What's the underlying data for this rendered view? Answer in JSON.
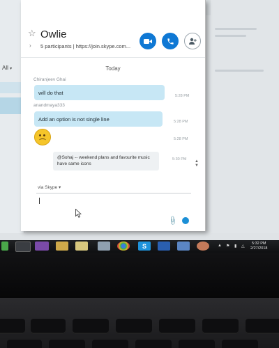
{
  "background_window": {
    "filter_label": "All",
    "filter_icon": "chevron-down-icon"
  },
  "chat": {
    "title": "Owlie",
    "participants": "5 participants | https://join.skype.com...",
    "icons": {
      "favorite": "star-icon",
      "expand": "chevron-right-icon",
      "video": "video-camera-icon",
      "call": "phone-icon",
      "add_people": "add-person-icon"
    },
    "accent_color": "#0f78d4",
    "bubble_color": "#c7e7f5"
  },
  "conversation": {
    "date_separator": "Today",
    "messages": [
      {
        "sender": "Chiranjeev Ghai",
        "text": "will do that",
        "time": "5:28 PM"
      },
      {
        "sender": "anandmaya333",
        "text": "Add an option is not single line",
        "time": "5:28 PM"
      },
      {
        "sender": "",
        "text": "",
        "emoji": "worried-face-icon",
        "time": "5:28 PM"
      },
      {
        "sender": "",
        "text": "@Sohaj -- weekend plans and favourite music have same icons",
        "time": "5:30 PM"
      }
    ]
  },
  "composer": {
    "via_label": "via Skype",
    "via_icon": "chevron-down-icon",
    "attach_icon": "paperclip-icon",
    "emoji_icon": "emoticon-icon"
  },
  "taskbar": {
    "apps": [
      "start-icon",
      "explorer-icon",
      "media-icon",
      "folder-icon",
      "files-icon",
      "app-icon",
      "chrome-icon",
      "skype-icon",
      "word-icon",
      "remote-icon",
      "app-icon"
    ],
    "skype_letter": "S",
    "clock_time": "5:32 PM",
    "clock_date": "2/27/2018"
  }
}
